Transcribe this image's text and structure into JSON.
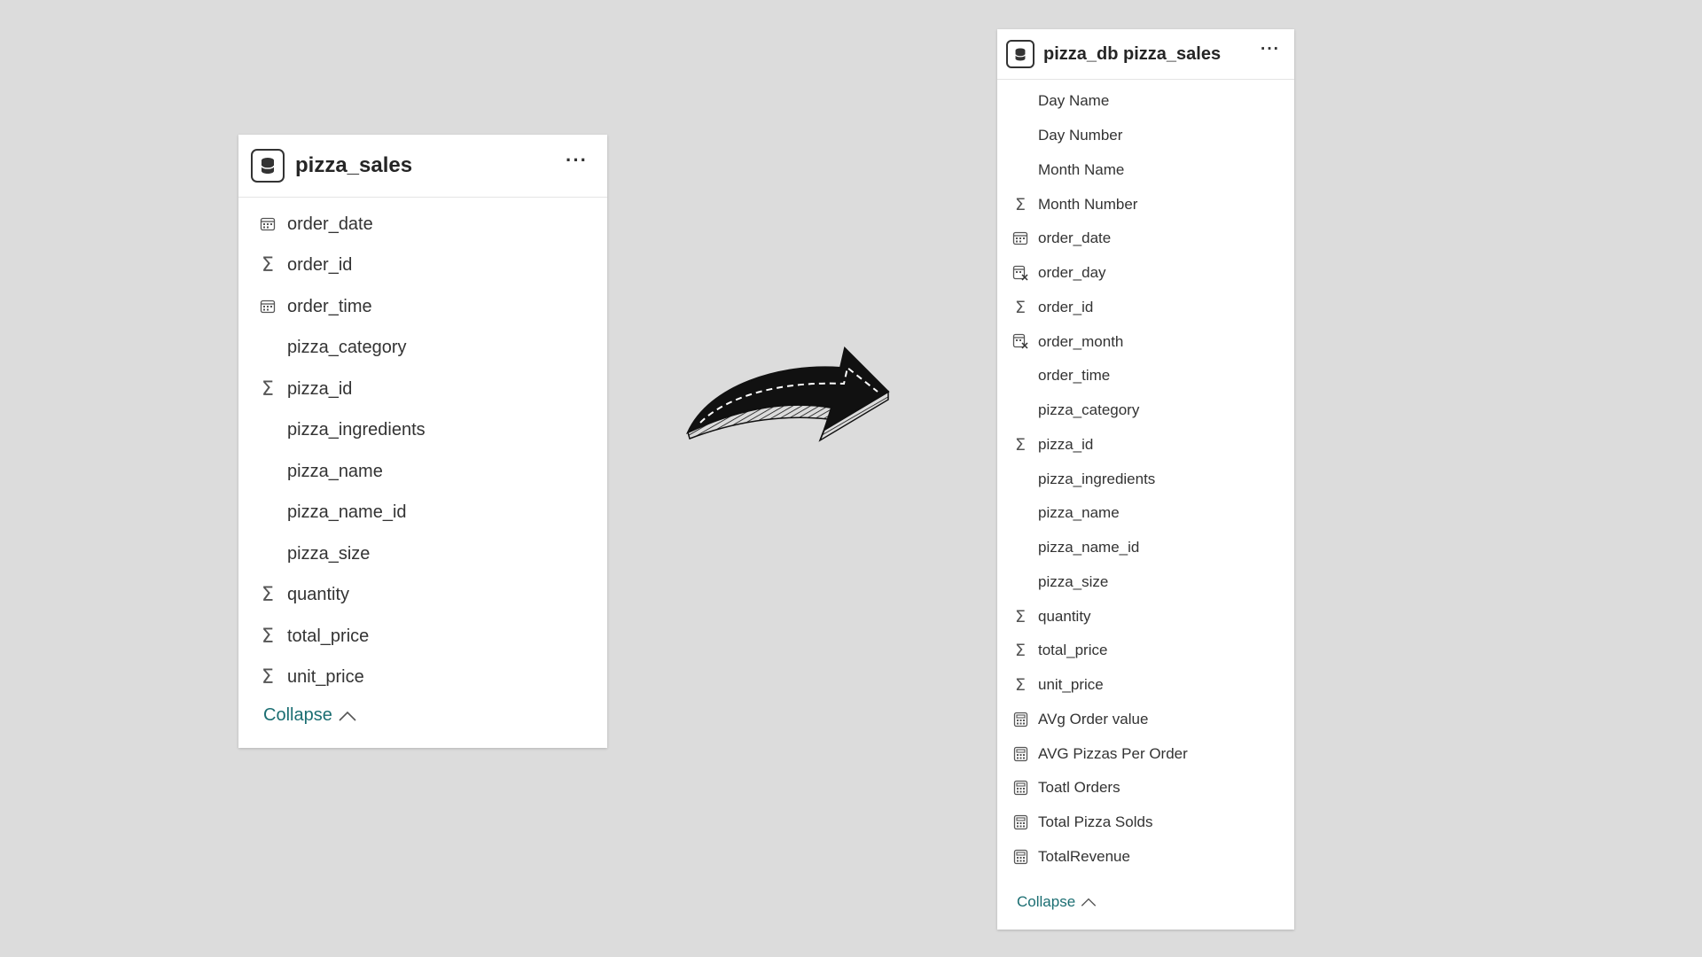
{
  "left_table": {
    "title": "pizza_sales",
    "menu": "···",
    "fields": [
      {
        "label": "order_date",
        "icon": "calendar-icon"
      },
      {
        "label": "order_id",
        "icon": "sigma-icon"
      },
      {
        "label": "order_time",
        "icon": "calendar-icon"
      },
      {
        "label": "pizza_category",
        "icon": ""
      },
      {
        "label": "pizza_id",
        "icon": "sigma-icon"
      },
      {
        "label": "pizza_ingredients",
        "icon": ""
      },
      {
        "label": "pizza_name",
        "icon": ""
      },
      {
        "label": "pizza_name_id",
        "icon": ""
      },
      {
        "label": "pizza_size",
        "icon": ""
      },
      {
        "label": "quantity",
        "icon": "sigma-icon"
      },
      {
        "label": "total_price",
        "icon": "sigma-icon"
      },
      {
        "label": "unit_price",
        "icon": "sigma-icon"
      }
    ],
    "collapse_label": "Collapse"
  },
  "right_table": {
    "title": "pizza_db pizza_sales",
    "menu": "···",
    "fields": [
      {
        "label": "Day Name",
        "icon": ""
      },
      {
        "label": "Day Number",
        "icon": ""
      },
      {
        "label": "Month Name",
        "icon": ""
      },
      {
        "label": "Month Number",
        "icon": "sigma-icon"
      },
      {
        "label": "order_date",
        "icon": "calendar-icon"
      },
      {
        "label": "order_day",
        "icon": "calculated-column-icon"
      },
      {
        "label": "order_id",
        "icon": "sigma-icon"
      },
      {
        "label": "order_month",
        "icon": "calculated-column-icon"
      },
      {
        "label": "order_time",
        "icon": ""
      },
      {
        "label": "pizza_category",
        "icon": ""
      },
      {
        "label": "pizza_id",
        "icon": "sigma-icon"
      },
      {
        "label": "pizza_ingredients",
        "icon": ""
      },
      {
        "label": "pizza_name",
        "icon": ""
      },
      {
        "label": "pizza_name_id",
        "icon": ""
      },
      {
        "label": "pizza_size",
        "icon": ""
      },
      {
        "label": "quantity",
        "icon": "sigma-icon"
      },
      {
        "label": "total_price",
        "icon": "sigma-icon"
      },
      {
        "label": "unit_price",
        "icon": "sigma-icon"
      },
      {
        "label": "AVg Order value",
        "icon": "measure-icon"
      },
      {
        "label": "AVG Pizzas Per Order",
        "icon": "measure-icon"
      },
      {
        "label": "Toatl Orders",
        "icon": "measure-icon"
      },
      {
        "label": "Total Pizza Solds",
        "icon": "measure-icon"
      },
      {
        "label": "TotalRevenue",
        "icon": "measure-icon"
      }
    ],
    "collapse_label": "Collapse"
  },
  "colors": {
    "background": "#dcdcdc",
    "card": "#ffffff",
    "collapse_link": "#1b6e72",
    "text": "#333333"
  }
}
